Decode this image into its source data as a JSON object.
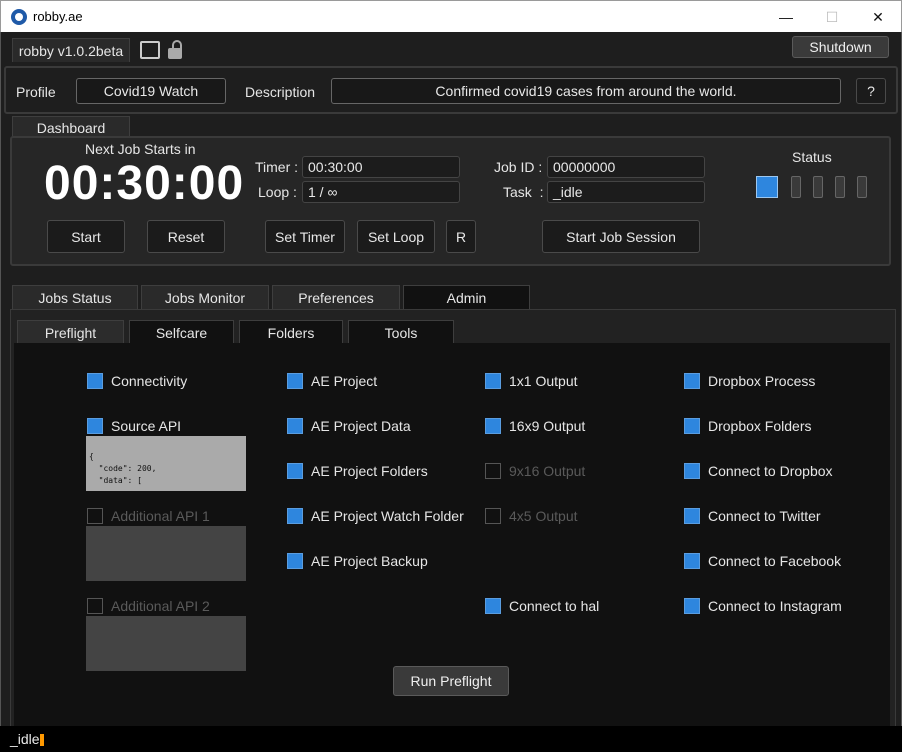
{
  "window": {
    "title": "robby.ae",
    "minimize": "—",
    "maximize": "☐",
    "close": "✕"
  },
  "header": {
    "version_tab": "robby v1.0.2beta",
    "shutdown": "Shutdown"
  },
  "profile": {
    "label": "Profile",
    "value": "Covid19 Watch",
    "desc_label": "Description",
    "desc_value": "Confirmed covid19 cases from around the world.",
    "help": "?"
  },
  "dashboard": {
    "tab": "Dashboard",
    "next_job_label": "Next Job Starts in",
    "countdown": "00:30:00",
    "start": "Start",
    "reset": "Reset",
    "timer_label": "Timer :",
    "timer_value": "00:30:00",
    "loop_label": "Loop :",
    "loop_value": "1 / ∞",
    "set_timer": "Set Timer",
    "set_loop": "Set Loop",
    "r": "R",
    "job_id_label": "Job ID :",
    "job_id_value": "00000000",
    "task_label": "Task  :",
    "task_value": "_idle",
    "start_session": "Start Job Session",
    "status_label": "Status"
  },
  "main_tabs": [
    "Jobs Status",
    "Jobs Monitor",
    "Preferences",
    "Admin"
  ],
  "sub_tabs": [
    "Preflight",
    "Selfcare",
    "Folders",
    "Tools"
  ],
  "preflight": {
    "col1": {
      "connectivity": "Connectivity",
      "source_api": "Source API",
      "source_api_text": "{\n  \"code\": 200,\n  \"data\": [",
      "additional_api_1": "Additional API 1",
      "additional_api_2": "Additional API 2"
    },
    "col2": [
      "AE Project",
      "AE Project Data",
      "AE Project Folders",
      "AE Project Watch Folder",
      "AE Project Backup"
    ],
    "col3": [
      "1x1 Output",
      "16x9 Output",
      "9x16 Output",
      "4x5 Output",
      "Connect to hal"
    ],
    "col4": [
      "Dropbox Process",
      "Dropbox Folders",
      "Connect to Dropbox",
      "Connect to Twitter",
      "Connect to Facebook",
      "Connect to Instagram"
    ],
    "run": "Run Preflight"
  },
  "footer": {
    "status": "_idle"
  },
  "colors": {
    "accent": "#2e86de",
    "indicator": "#ff9900"
  }
}
